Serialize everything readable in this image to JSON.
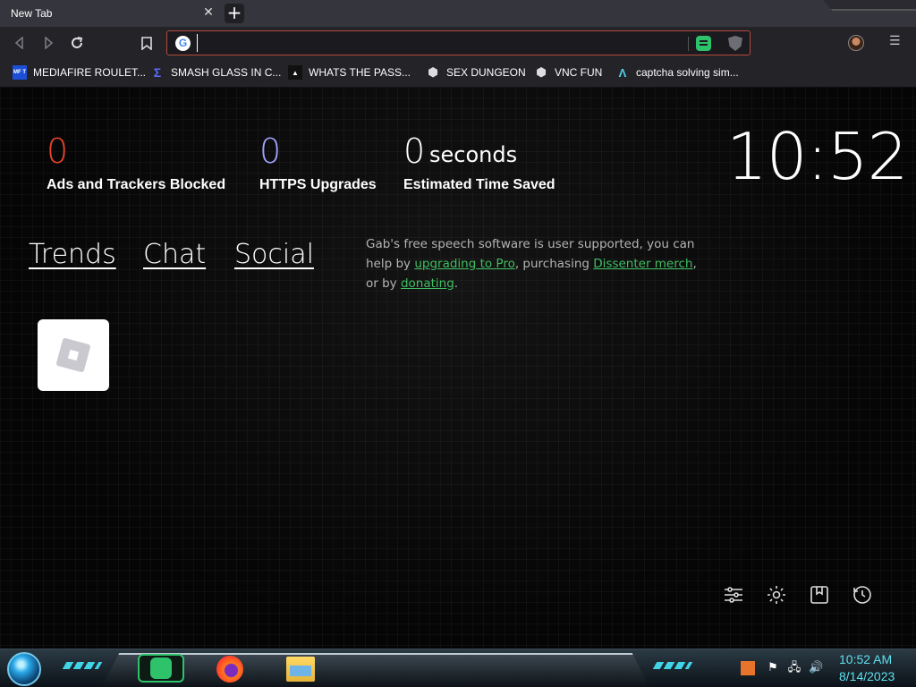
{
  "browser": {
    "tab_title": "New Tab",
    "tab_close": "✕",
    "new_tab": "+",
    "url_value": "",
    "url_placeholder": "",
    "menu": "☰"
  },
  "bookmarks": [
    {
      "label": "MEDIAFIRE ROULET...",
      "icon": "MF T"
    },
    {
      "label": "SMASH GLASS IN C...",
      "icon": "Σ"
    },
    {
      "label": "WHATS THE PASS...",
      "icon": "▲"
    },
    {
      "label": "SEX DUNGEON",
      "icon": "⬢"
    },
    {
      "label": "VNC FUN",
      "icon": "⬢"
    },
    {
      "label": "captcha solving sim...",
      "icon": "Λ"
    }
  ],
  "stats": {
    "ads": {
      "value": "0",
      "label": "Ads and Trackers Blocked",
      "color": "#e8452c"
    },
    "https": {
      "value": "0",
      "label": "HTTPS Upgrades",
      "color": "#a3a3ff"
    },
    "time": {
      "value": "0",
      "unit": "seconds",
      "label": "Estimated Time Saved"
    }
  },
  "clock": "10:52",
  "nav": {
    "trends": "Trends",
    "chat": "Chat",
    "social": "Social"
  },
  "gab": {
    "t1": "Gab's free speech software is user supported, you can help by ",
    "l1": "upgrading to Pro",
    "t2": ", purchasing ",
    "l2": "Dissenter merch",
    "t3": ", or by ",
    "l3": "donating",
    "t4": "."
  },
  "tiles": [
    {
      "name": "Roblox"
    }
  ],
  "corner_buttons": [
    "sliders-icon",
    "gear-icon",
    "bookmark-icon",
    "history-icon"
  ],
  "taskbar": {
    "time": "10:52 AM",
    "date": "8/14/2023"
  },
  "colors": {
    "accent_green": "#3fbf62",
    "url_border": "#b44a3a"
  }
}
